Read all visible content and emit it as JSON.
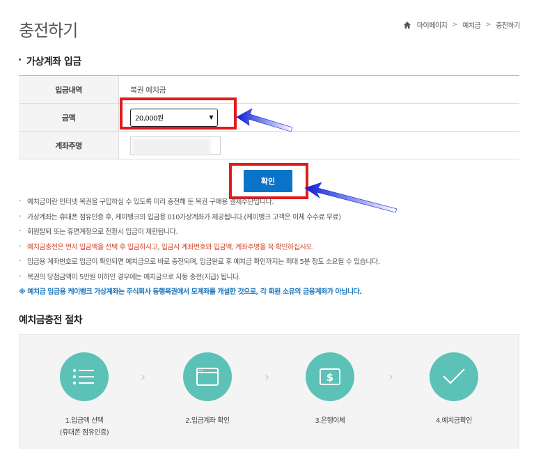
{
  "page_title": "충전하기",
  "breadcrumb": [
    "마이페이지",
    "예치금",
    "충전하기"
  ],
  "section_title": "가상계좌 입금",
  "form": {
    "rows": [
      {
        "label": "입금내역",
        "value": "복권 예치금"
      },
      {
        "label": "금액",
        "value": "20,000원"
      },
      {
        "label": "계좌주명",
        "value": ""
      }
    ]
  },
  "confirm_label": "확인",
  "notes": [
    "예치금이란 인터넷 복권을 구입하실 수 있도록 미리 충전해 둔 복권 구매용 결제수단입니다.",
    "가상계좌는 휴대폰 점유인증 후, 케이뱅크의 입금용 010가상계좌가 제공됩니다.(케이뱅크 고객은 이체 수수료 무료)",
    "회원탈퇴 또는 휴면계정으로 전환시 입금이 제한됩니다.",
    "예치금충전은 먼저 입금액을 선택 후 입금하시고, 입금시 계좌번호와 입금액, 계좌주명을 꼭 확인하십시오.",
    "입금용 계좌번호로 입금이 확인되면 예치금으로 바로 충전되며, 입금완료 후 예치금 확인까지는 최대 5분 정도 소요될 수 있습니다.",
    "복권의 당첨금액이 5만원 이하인 경우에는 예치금으로 자동 충전(지급) 됩니다."
  ],
  "notice": "※ 예치금 입금용 케이뱅크 가상계좌는 주식회사 동행복권에서 모계좌를 개설한 것으로, 각 회원 소유의 금융계좌가 아닙니다.",
  "process_title": "예치금충전 절차",
  "steps": [
    {
      "label_1": "1.입금액 선택",
      "label_2": "(휴대폰 점유인증)",
      "icon": "list-icon"
    },
    {
      "label_1": "2.입금계좌 확인",
      "label_2": "",
      "icon": "window-icon"
    },
    {
      "label_1": "3.은행이체",
      "label_2": "",
      "icon": "dollar-icon"
    },
    {
      "label_1": "4.예치금확인",
      "label_2": "",
      "icon": "check-icon"
    }
  ],
  "colors": {
    "accent": "#0a74c9",
    "teal": "#5cc2b8",
    "highlight": "#e21a1a",
    "warning": "#d0442a",
    "notice": "#1c75b9"
  }
}
